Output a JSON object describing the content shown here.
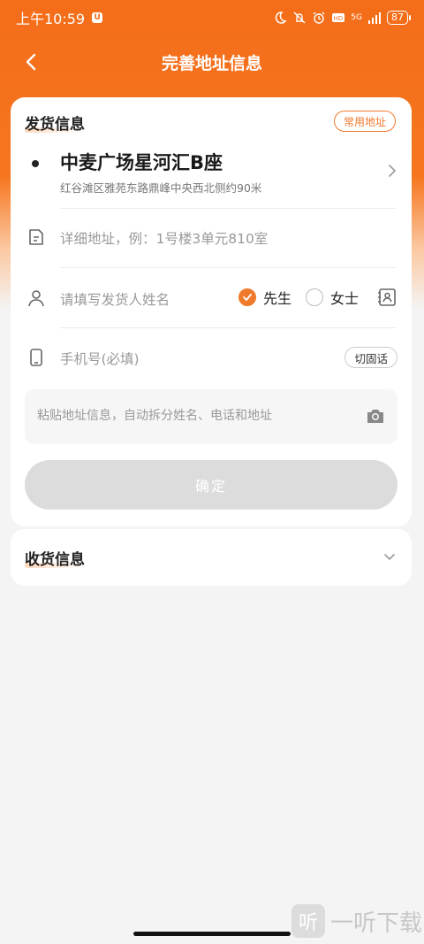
{
  "status_bar": {
    "time": "上午10:59",
    "badge": "U",
    "network": "5G",
    "battery": "87"
  },
  "header": {
    "title": "完善地址信息"
  },
  "sender": {
    "title": "发货信息",
    "common_address_label": "常用地址",
    "address_main": "中麦广场星河汇B座",
    "address_sub": "红谷滩区雅苑东路鼎峰中央西北侧约90米",
    "detail_placeholder": "详细地址，例：1号楼3单元810室",
    "name_placeholder": "请填写发货人姓名",
    "gender_options": [
      {
        "label": "先生",
        "selected": true
      },
      {
        "label": "女士",
        "selected": false
      }
    ],
    "phone_placeholder": "手机号(必填)",
    "landline_label": "切固话",
    "paste_placeholder": "粘贴地址信息，自动拆分姓名、电话和地址",
    "confirm_label": "确定"
  },
  "receiver": {
    "title": "收货信息"
  },
  "watermark": {
    "logo_char": "听",
    "text": "一听下载"
  },
  "colors": {
    "accent": "#f07a2c",
    "header_bg": "#f46d1a",
    "disabled_button": "#dcdcdc"
  }
}
